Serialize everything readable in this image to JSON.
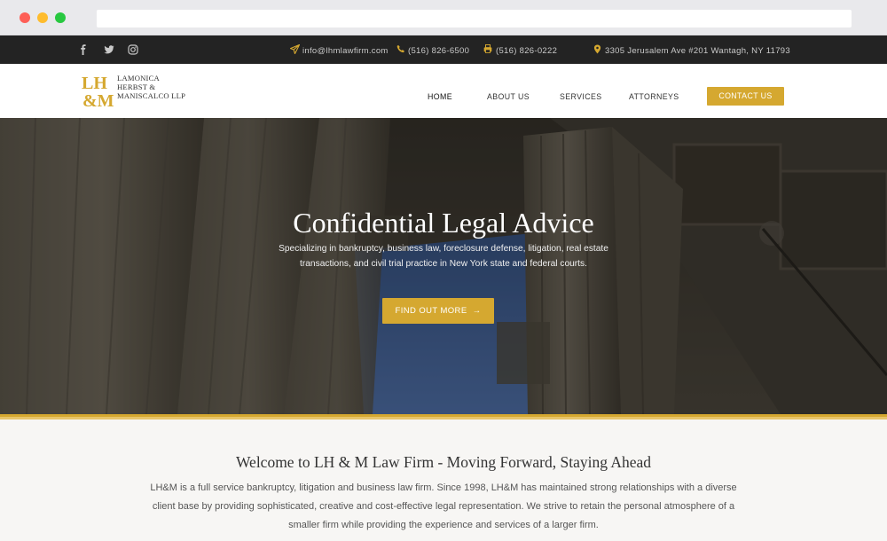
{
  "topbar": {
    "email": "info@lhmlawfirm.com",
    "phone": "(516) 826-6500",
    "fax": "(516) 826-0222",
    "address": "3305 Jerusalem Ave #201 Wantagh, NY 11793",
    "social_icons": [
      "facebook-icon",
      "twitter-icon",
      "instagram-icon"
    ]
  },
  "logo": {
    "mark_top": "LH",
    "mark_bottom": "&M",
    "line1": "LAMONICA",
    "line2": "HERBST &",
    "line3": "MANISCALCO LLP"
  },
  "nav": {
    "items": [
      {
        "label": "HOME"
      },
      {
        "label": "ABOUT US"
      },
      {
        "label": "SERVICES"
      },
      {
        "label": "ATTORNEYS"
      }
    ],
    "contact_label": "CONTACT US"
  },
  "hero": {
    "title": "Confidential Legal Advice",
    "subtitle": "Specializing in bankruptcy, business law, foreclosure defense, litigation, real estate transactions, and civil trial practice in New York state and federal courts.",
    "button_label": "FIND OUT MORE",
    "button_arrow": "→"
  },
  "welcome": {
    "title": "Welcome to LH & M Law Firm - Moving Forward, Staying Ahead",
    "body": "LH&M is a full service bankruptcy, litigation and business law firm. Since 1998, LH&M has maintained strong relationships with a diverse client base by providing sophisticated, creative and cost-effective legal representation. We strive to retain the personal atmosphere of a smaller firm while providing the experience and services of a larger firm."
  },
  "colors": {
    "accent": "#d5a830",
    "topbar_bg": "#232323",
    "welcome_bg": "#f7f6f4"
  }
}
